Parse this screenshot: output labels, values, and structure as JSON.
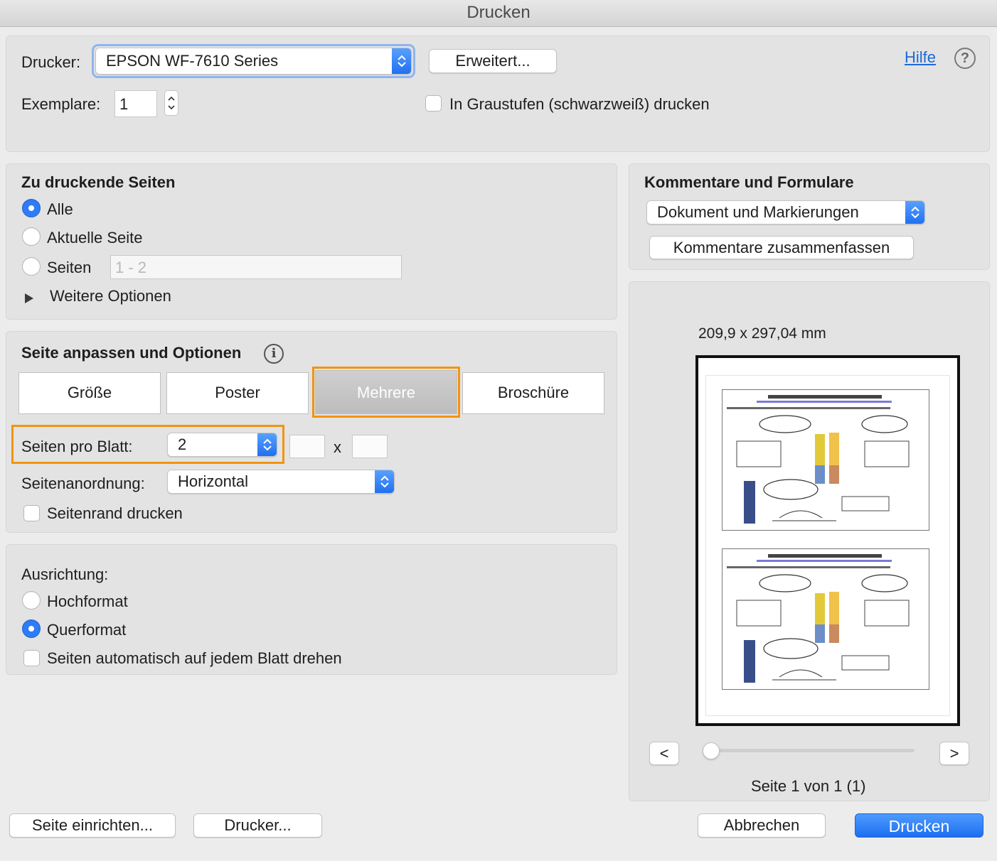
{
  "window": {
    "title": "Drucken"
  },
  "top": {
    "printer_label": "Drucker:",
    "printer_value": "EPSON WF-7610 Series",
    "advanced_button": "Erweitert...",
    "help_link": "Hilfe",
    "help_icon": "?",
    "copies_label": "Exemplare:",
    "copies_value": "1",
    "grayscale_label": "In Graustufen (schwarzweiß) drucken"
  },
  "pages": {
    "heading": "Zu druckende Seiten",
    "all": "Alle",
    "current": "Aktuelle Seite",
    "pages": "Seiten",
    "range_placeholder": "1 - 2",
    "more_options": "Weitere Optionen"
  },
  "sizing": {
    "heading": "Seite anpassen und Optionen",
    "info_icon": "i",
    "tabs": [
      "Größe",
      "Poster",
      "Mehrere",
      "Broschüre"
    ],
    "pages_per_sheet_label": "Seiten pro Blatt:",
    "pages_per_sheet_value": "2",
    "times": "x",
    "order_label": "Seitenanordnung:",
    "order_value": "Horizontal",
    "border_label": "Seitenrand drucken"
  },
  "orientation": {
    "heading": "Ausrichtung:",
    "portrait": "Hochformat",
    "landscape": "Querformat",
    "auto_rotate": "Seiten automatisch auf jedem Blatt drehen"
  },
  "comments": {
    "heading": "Kommentare und Formulare",
    "select_value": "Dokument und Markierungen",
    "summarize_button": "Kommentare zusammenfassen"
  },
  "preview": {
    "size": "209,9 x 297,04 mm",
    "prev": "<",
    "next": ">",
    "page_status": "Seite 1 von 1 (1)",
    "slider_value": 0
  },
  "footer": {
    "page_setup": "Seite einrichten...",
    "printer": "Drucker...",
    "cancel": "Abbrechen",
    "print": "Drucken"
  },
  "colors": {
    "accent": "#2e7cf6",
    "highlight": "#f2930f"
  }
}
